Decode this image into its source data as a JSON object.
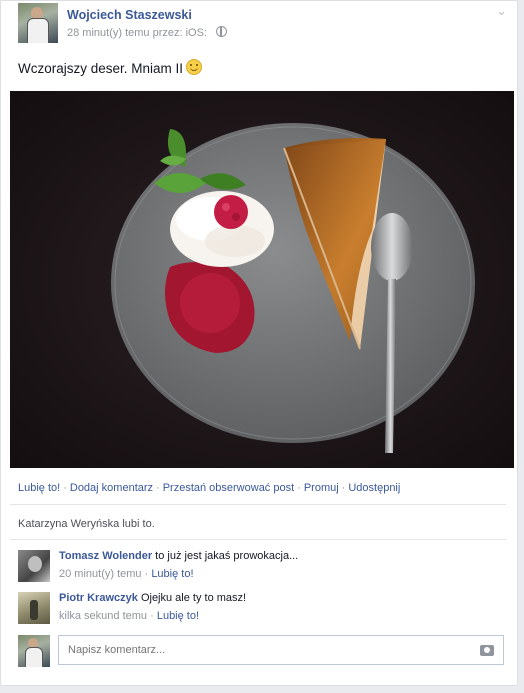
{
  "post": {
    "author": "Wojciech Staszewski",
    "meta": "28 minut(y) temu przez: iOS:",
    "status": "Wczorajszy deser. Mniam II",
    "privacy_icon": "globe-icon",
    "emoticon_icon": "smiley-icon"
  },
  "actions": [
    {
      "label": "Lubię to!"
    },
    {
      "label": "Dodaj komentarz"
    },
    {
      "label": "Przestań obserwować post"
    },
    {
      "label": "Promuj"
    },
    {
      "label": "Udostępnij"
    }
  ],
  "likes": "Katarzyna Weryńska lubi to.",
  "comments": [
    {
      "author": "Tomasz Wolender",
      "text": "to już jest jakaś prowokacja...",
      "time": "20 minut(y) temu",
      "like": "Lubię to!"
    },
    {
      "author": "Piotr Krawczyk",
      "text": "Ojejku ale ty to masz!",
      "time": "kilka sekund temu",
      "like": "Lubię to!"
    }
  ],
  "composer": {
    "placeholder": "Napisz komentarz...",
    "camera_icon": "camera-icon"
  },
  "colors": {
    "link": "#3b5998",
    "muted": "#90949c",
    "plate": "#7c7e80"
  }
}
